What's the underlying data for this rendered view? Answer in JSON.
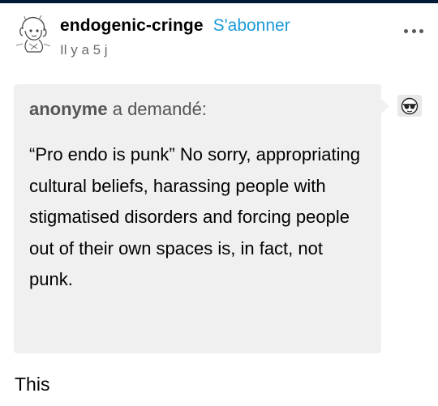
{
  "post": {
    "blog_name": "endogenic-cringe",
    "follow_label": "S'abonner",
    "timestamp": "Il y a 5 j",
    "more_icon": "more-horizontal-icon",
    "avatar_icon": "sketch-avatar-icon"
  },
  "ask": {
    "asker": "anonyme",
    "asked_label": "a demandé:",
    "question": "“Pro endo is punk” No sorry, appropriating cultural beliefs, harassing people with stigmatised disorders and forcing people out of their own spaces is, in fact, not punk.",
    "asker_avatar_icon": "anonymous-sunglasses-avatar-icon"
  },
  "answer": {
    "text": "This"
  },
  "colors": {
    "accent": "#1b9bd8",
    "top_bar": "#001935",
    "bubble_bg": "#f0f0f0",
    "muted_text": "#6b6b6b"
  }
}
